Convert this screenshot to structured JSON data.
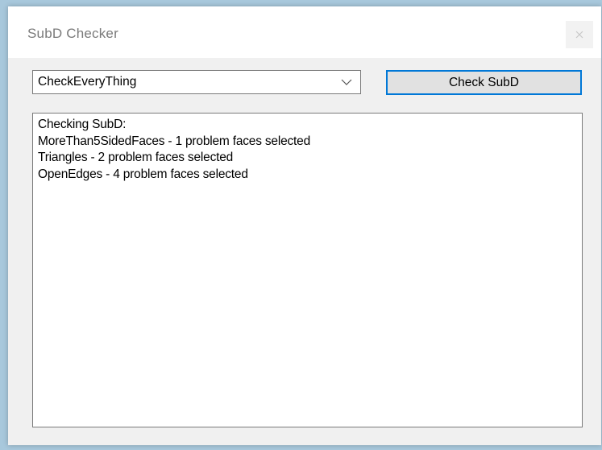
{
  "window": {
    "title": "SubD Checker",
    "close_icon": "close-icon"
  },
  "controls": {
    "check_mode": {
      "selected": "CheckEveryThing",
      "arrow_icon": "chevron-down-icon"
    },
    "check_button_label": "Check SubD"
  },
  "output": {
    "lines": [
      "Checking SubD:",
      "MoreThan5SidedFaces - 1 problem faces selected",
      "Triangles - 2 problem faces selected",
      "OpenEdges - 4 problem faces selected"
    ]
  },
  "colors": {
    "accent": "#0078d7",
    "window_bg": "#f0f0f0",
    "desktop_bg": "#a8c8dc"
  }
}
